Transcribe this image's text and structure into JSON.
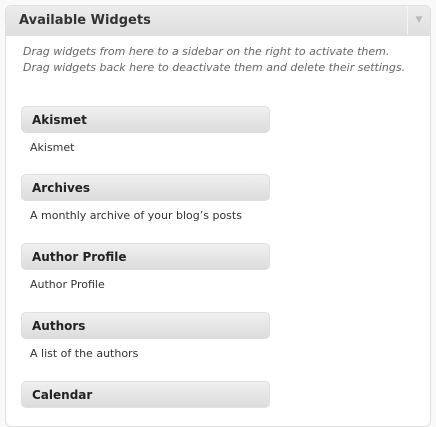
{
  "panel": {
    "title": "Available Widgets",
    "toggle_icon": "▼",
    "description": "Drag widgets from here to a sidebar on the right to activate them. Drag widgets back here to deactivate them and delete their settings."
  },
  "widgets": [
    {
      "title": "Akismet",
      "description": "Akismet"
    },
    {
      "title": "Archives",
      "description": "A monthly archive of your blog’s posts"
    },
    {
      "title": "Author Profile",
      "description": "Author Profile"
    },
    {
      "title": "Authors",
      "description": "A list of the authors"
    },
    {
      "title": "Calendar",
      "description": ""
    }
  ]
}
